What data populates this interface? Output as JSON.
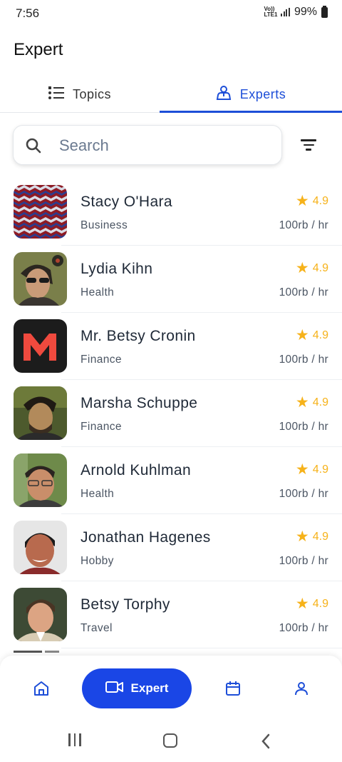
{
  "status_bar": {
    "time": "7:56",
    "network": "Vo)) LTE1",
    "battery": "99%"
  },
  "page": {
    "title": "Expert"
  },
  "tabs": [
    {
      "label": "Topics",
      "icon": "list-icon",
      "active": false
    },
    {
      "label": "Experts",
      "icon": "person-badge-icon",
      "active": true
    }
  ],
  "search": {
    "placeholder": "Search",
    "value": ""
  },
  "filter": {
    "icon": "filter-icon"
  },
  "experts": [
    {
      "name": "Stacy O'Hara",
      "category": "Business",
      "rating": "4.9",
      "price": "100rb / hr",
      "avatar": "red-pattern"
    },
    {
      "name": "Lydia Kihn",
      "category": "Health",
      "rating": "4.9",
      "price": "100rb / hr",
      "avatar": "photo"
    },
    {
      "name": "Mr. Betsy Cronin",
      "category": "Finance",
      "rating": "4.9",
      "price": "100rb / hr",
      "avatar": "m-logo"
    },
    {
      "name": "Marsha Schuppe",
      "category": "Finance",
      "rating": "4.9",
      "price": "100rb / hr",
      "avatar": "photo"
    },
    {
      "name": "Arnold Kuhlman",
      "category": "Health",
      "rating": "4.9",
      "price": "100rb / hr",
      "avatar": "photo"
    },
    {
      "name": "Jonathan Hagenes",
      "category": "Hobby",
      "rating": "4.9",
      "price": "100rb / hr",
      "avatar": "photo"
    },
    {
      "name": "Betsy Torphy",
      "category": "Travel",
      "rating": "4.9",
      "price": "100rb / hr",
      "avatar": "photo"
    }
  ],
  "bottom_nav": {
    "home_icon": "home-icon",
    "expert_label": "Expert",
    "expert_icon": "video-camera-icon",
    "calendar_icon": "calendar-icon",
    "profile_icon": "person-icon"
  },
  "colors": {
    "accent": "#1a46e6",
    "tab_active": "#1d4ed8",
    "star": "#f6b21a"
  }
}
